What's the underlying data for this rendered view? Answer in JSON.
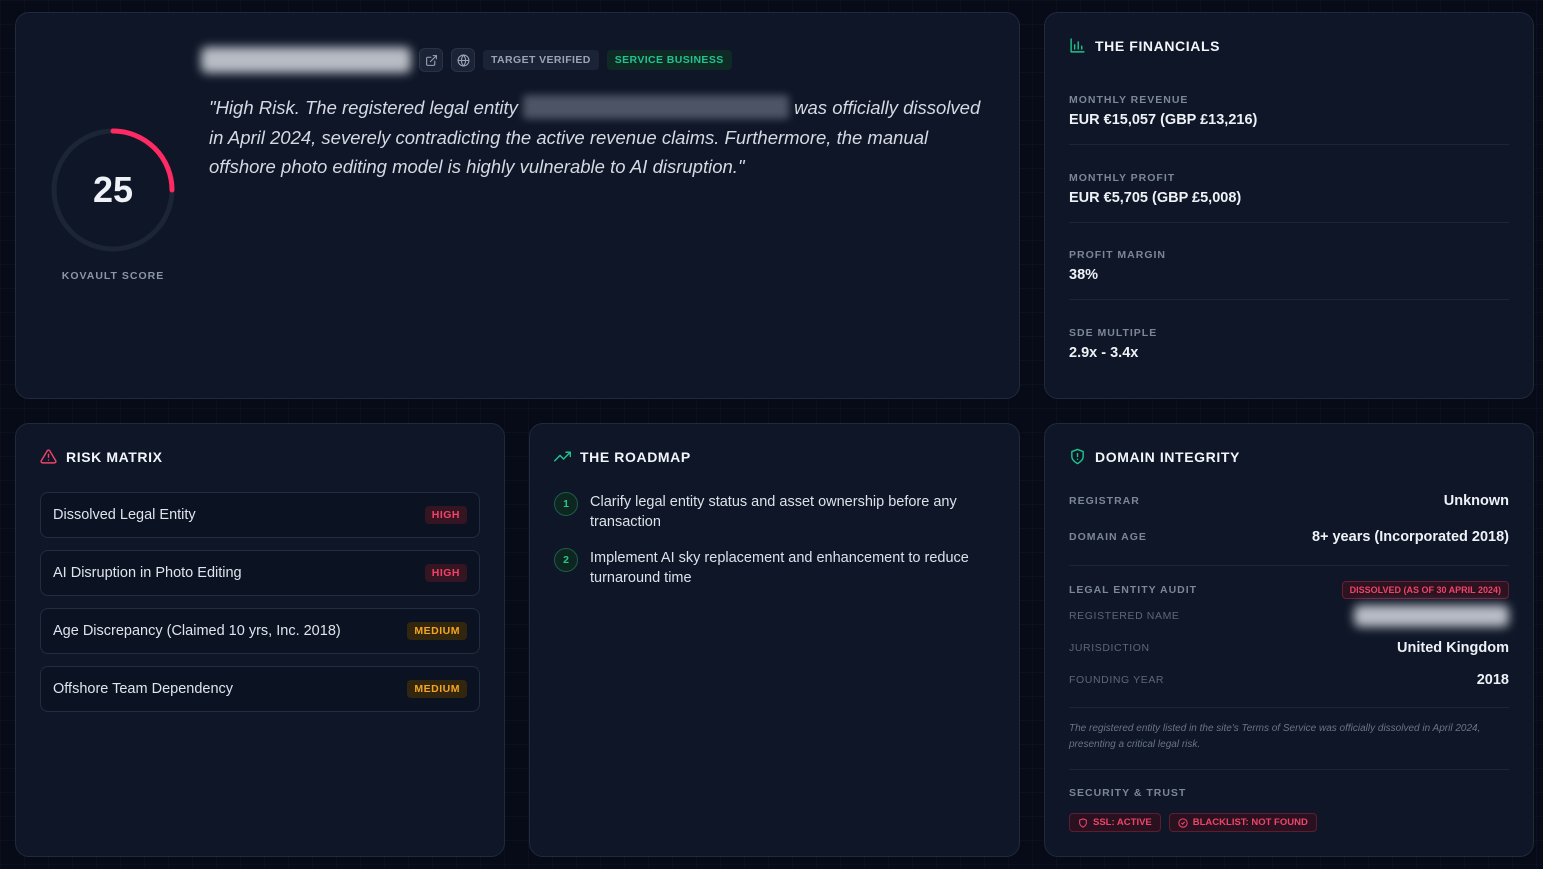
{
  "hero": {
    "name_redacted": "",
    "tags": {
      "verified": "TARGET VERIFIED",
      "service": "SERVICE BUSINESS"
    },
    "quote_start": "\"High Risk. The registered legal entity",
    "quote_end": "was officially dissolved in April 2024, severely contradicting the active revenue claims. Furthermore, the manual offshore photo editing model is highly vulnerable to AI disruption.\"",
    "score": "25",
    "score_fraction": 0.25,
    "score_label": "KOVAULT SCORE",
    "score_color": "#ff2a63"
  },
  "financials": {
    "title": "THE FINANCIALS",
    "items": [
      {
        "label": "MONTHLY REVENUE",
        "value": "EUR €15,057 (GBP £13,216)"
      },
      {
        "label": "MONTHLY PROFIT",
        "value": "EUR €5,705 (GBP £5,008)"
      },
      {
        "label": "PROFIT MARGIN",
        "value": "38%"
      },
      {
        "label": "SDE MULTIPLE",
        "value": "2.9x - 3.4x"
      }
    ]
  },
  "risk": {
    "title": "RISK MATRIX",
    "items": [
      {
        "label": "Dissolved Legal Entity",
        "level": "HIGH"
      },
      {
        "label": "AI Disruption in Photo Editing",
        "level": "HIGH"
      },
      {
        "label": "Age Discrepancy (Claimed 10 yrs, Inc. 2018)",
        "level": "MEDIUM"
      },
      {
        "label": "Offshore Team Dependency",
        "level": "MEDIUM"
      }
    ]
  },
  "roadmap": {
    "title": "THE ROADMAP",
    "steps": [
      {
        "num": "1",
        "text": "Clarify legal entity status and asset ownership before any transaction"
      },
      {
        "num": "2",
        "text": "Implement AI sky replacement and enhancement to reduce turnaround time"
      }
    ]
  },
  "domain": {
    "title": "DOMAIN INTEGRITY",
    "registrar_label": "REGISTRAR",
    "registrar_value": "Unknown",
    "age_label": "DOMAIN AGE",
    "age_value": "8+ years (Incorporated 2018)",
    "audit_label": "LEGAL ENTITY AUDIT",
    "audit_badge": "DISSOLVED (AS OF 30 APRIL 2024)",
    "reg_name_label": "REGISTERED NAME",
    "jurisdiction_label": "JURISDICTION",
    "jurisdiction_value": "United Kingdom",
    "founding_label": "FOUNDING YEAR",
    "founding_value": "2018",
    "note": "The registered entity listed in the site's Terms of Service was officially dissolved in April 2024, presenting a critical legal risk.",
    "security_label": "SECURITY & TRUST",
    "ssl_badge": "SSL: ACTIVE",
    "blacklist_badge": "BLACKLIST: NOT FOUND"
  }
}
